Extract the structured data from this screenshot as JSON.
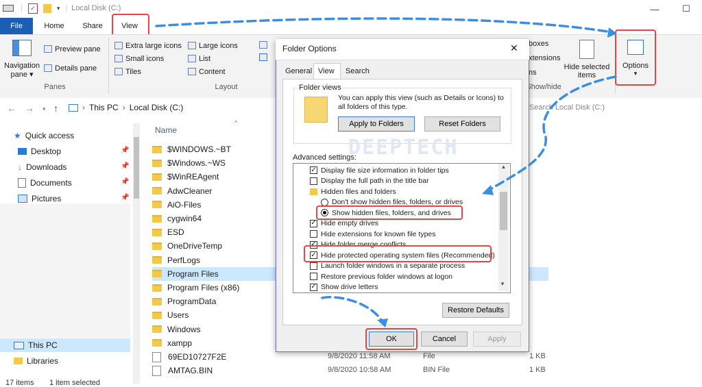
{
  "window": {
    "title": "Local Disk (C:)",
    "controls": [
      "—",
      "☐"
    ]
  },
  "ribbon": {
    "tabs": {
      "file": "File",
      "home": "Home",
      "share": "Share",
      "view": "View"
    },
    "panes": {
      "navigation_pane": "Navigation",
      "navigation_pane2": "pane ▾",
      "preview_pane": "Preview pane",
      "details_pane": "Details pane",
      "group_label": "Panes"
    },
    "layout": {
      "extra_large": "Extra large icons",
      "large": "Large icons",
      "small": "Small icons",
      "list": "List",
      "tiles": "Tiles",
      "content": "Content",
      "group_label": "Layout"
    },
    "show_hide": {
      "boxes": "boxes",
      "extensions": "xtensions",
      "ns": "ns",
      "hide_selected": "Hide selected",
      "items": "items",
      "group_label": "Show/hide"
    },
    "options": {
      "label": "Options",
      "chevron": "▾"
    }
  },
  "address": {
    "this_pc": "This PC",
    "separator": "›",
    "local_disk": "Local Disk (C:)",
    "search_placeholder": "Search Local Disk (C:)"
  },
  "nav": {
    "items": [
      {
        "label": "Quick access"
      },
      {
        "label": "Desktop"
      },
      {
        "label": "Downloads"
      },
      {
        "label": "Documents"
      },
      {
        "label": "Pictures"
      },
      {
        "label": "This PC"
      },
      {
        "label": "Libraries"
      }
    ]
  },
  "files": {
    "header_name": "Name",
    "rows": [
      {
        "name": "$WINDOWS.~BT"
      },
      {
        "name": "$Windows.~WS"
      },
      {
        "name": "$WinREAgent"
      },
      {
        "name": "AdwCleaner"
      },
      {
        "name": "AiO-Files"
      },
      {
        "name": "cygwin64"
      },
      {
        "name": "ESD"
      },
      {
        "name": "OneDriveTemp"
      },
      {
        "name": "PerfLogs"
      },
      {
        "name": "Program Files"
      },
      {
        "name": "Program Files (x86)"
      },
      {
        "name": "ProgramData"
      },
      {
        "name": "Users"
      },
      {
        "name": "Windows"
      },
      {
        "name": "xampp"
      },
      {
        "name": "69ED10727F2E",
        "date": "9/8/2020 11:58 AM",
        "type": "File",
        "size": "1 KB"
      },
      {
        "name": "AMTAG.BIN",
        "date": "9/8/2020 10:58 AM",
        "type": "BIN File",
        "size": "1 KB"
      }
    ]
  },
  "status": {
    "items": "17 items",
    "selected": "1 item selected"
  },
  "dialog": {
    "title": "Folder Options",
    "close": "✕",
    "tabs": [
      "General",
      "View",
      "Search"
    ],
    "folder_views": {
      "group_label": "Folder views",
      "description": "You can apply this view (such as Details or Icons) to all folders of this type.",
      "apply": "Apply to Folders",
      "reset": "Reset Folders"
    },
    "watermark": "DEEPTECH",
    "advanced_label": "Advanced settings:",
    "advanced": {
      "r0": "Display file size information in folder tips",
      "r1": "Display the full path in the title bar",
      "r2": "Hidden files and folders",
      "r3": "Don't show hidden files, folders, or drives",
      "r4": "Show hidden files, folders, and drives",
      "r5": "Hide empty drives",
      "r6": "Hide extensions for known file types",
      "r7": "Hide folder merge conflicts",
      "r8": "Hide protected operating system files (Recommended)",
      "r9": "Launch folder windows in a separate process",
      "r10": "Restore previous folder windows at logon",
      "r11": "Show drive letters"
    },
    "restore_defaults": "Restore Defaults",
    "ok": "OK",
    "cancel": "Cancel",
    "apply": "Apply"
  }
}
